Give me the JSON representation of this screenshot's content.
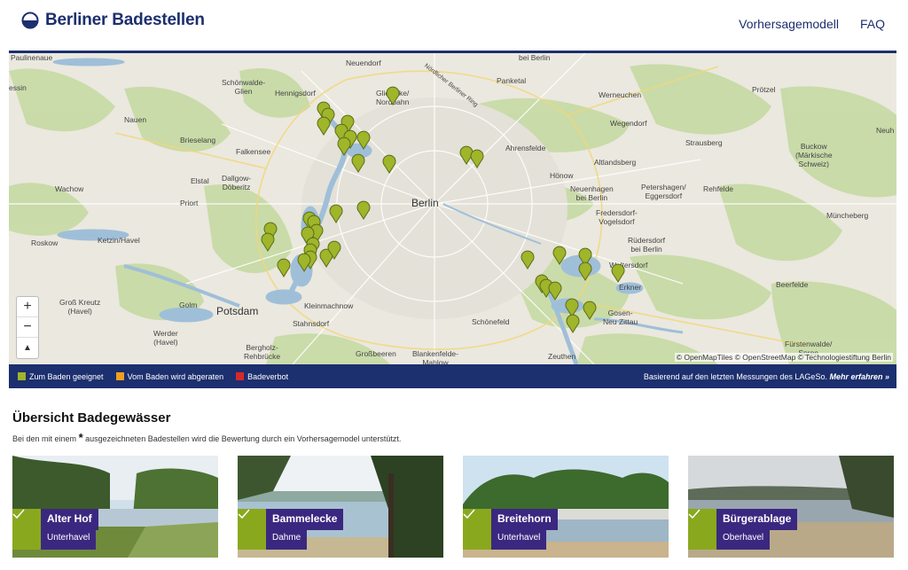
{
  "header": {
    "title": "Berliner Badestellen",
    "nav": [
      "Vorhersagemodell",
      "FAQ"
    ]
  },
  "map": {
    "places": [
      {
        "name": "Paulinenaue"
      },
      {
        "name": "Neuendorf"
      },
      {
        "name": "Nördlicher Berliner Ring"
      },
      {
        "name": "bei Berlin"
      },
      {
        "name": "essin"
      },
      {
        "name": "Schönwalde-\nGlien"
      },
      {
        "name": "Hennigsdorf"
      },
      {
        "name": "Glienicke/\nNordbahn"
      },
      {
        "name": "Panketal"
      },
      {
        "name": "Werneuchen"
      },
      {
        "name": "Prötzel"
      },
      {
        "name": "Nauen"
      },
      {
        "name": "Wegendorf"
      },
      {
        "name": "Neuh"
      },
      {
        "name": "Brieselang"
      },
      {
        "name": "Falkensee"
      },
      {
        "name": "Ahrensfelde"
      },
      {
        "name": "Strausberg"
      },
      {
        "name": "Buckow\n(Märkische\nSchweiz)"
      },
      {
        "name": "Altlandsberg"
      },
      {
        "name": "Elstal"
      },
      {
        "name": "Dallgow-\nDöberitz"
      },
      {
        "name": "Hönow"
      },
      {
        "name": "Wachow"
      },
      {
        "name": "Neuenhagen\nbei Berlin"
      },
      {
        "name": "Petershagen/\nEggersdorf"
      },
      {
        "name": "Rehfelde"
      },
      {
        "name": "Priort"
      },
      {
        "name": "Berlin"
      },
      {
        "name": "Fredersdorf-\nVogelsdorf"
      },
      {
        "name": "Müncheberg"
      },
      {
        "name": "Roskow"
      },
      {
        "name": "Ketzin/Havel"
      },
      {
        "name": "Rüdersdorf\nbei Berlin"
      },
      {
        "name": "Woltersdorf"
      },
      {
        "name": "Erkner"
      },
      {
        "name": "Beerfelde"
      },
      {
        "name": "Groß Kreutz\n(Havel)"
      },
      {
        "name": "Golm"
      },
      {
        "name": "Potsdam"
      },
      {
        "name": "Kleinmachnow"
      },
      {
        "name": "Stahnsdorf"
      },
      {
        "name": "Schönefeld"
      },
      {
        "name": "Gosen-\nNeu Zittau"
      },
      {
        "name": "Werder\n(Havel)"
      },
      {
        "name": "Bergholz-\nRehbrücke"
      },
      {
        "name": "Großbeeren"
      },
      {
        "name": "Blankenfelde-\nMahlow"
      },
      {
        "name": "Zeuthen"
      },
      {
        "name": "Fürstenwalde/\nSpree"
      }
    ],
    "zoom_in": "+",
    "zoom_out": "−",
    "compass": "▲",
    "attribution": "© OpenMapTiles © OpenStreetMap © Technologiestiftung Berlin",
    "marker_color": "#9fb52a"
  },
  "legend": {
    "items": [
      {
        "label": "Zum Baden geeignet",
        "color": "#9fb52a"
      },
      {
        "label": "Vom Baden wird abgeraten",
        "color": "#f0a020"
      },
      {
        "label": "Badeverbot",
        "color": "#d8282a"
      }
    ],
    "note": "Basierend auf den letzten Messungen des LAGeSo.",
    "link": "Mehr erfahren »"
  },
  "overview": {
    "title": "Übersicht Badegewässer",
    "subtitle_before": "Bei den mit einem",
    "star": "*",
    "subtitle_after": "ausgezeichneten Badestellen wird die Bewertung durch ein Vorhersagemodel unterstützt."
  },
  "cards": [
    {
      "name": "Alter Hof",
      "region": "Unterhavel"
    },
    {
      "name": "Bammelecke",
      "region": "Dahme"
    },
    {
      "name": "Breitehorn",
      "region": "Unterhavel"
    },
    {
      "name": "Bürgerablage",
      "region": "Oberhavel"
    }
  ]
}
